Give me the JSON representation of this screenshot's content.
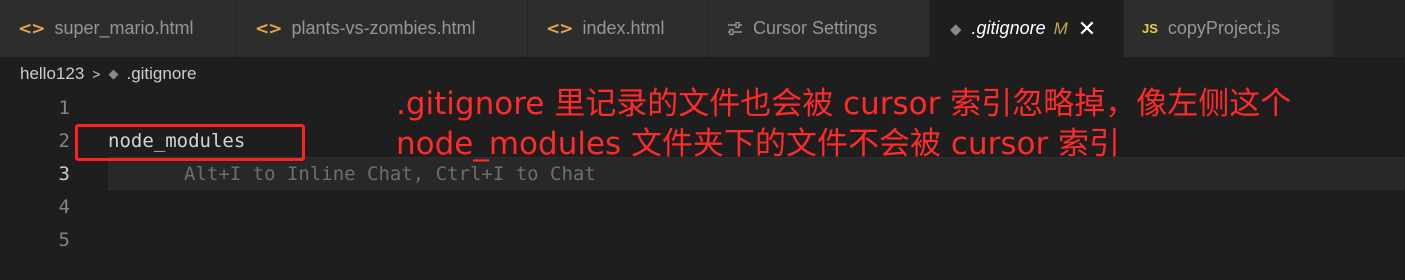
{
  "tabs": [
    {
      "label": "super_mario.html",
      "icon": "html-file-icon"
    },
    {
      "label": "plants-vs-zombies.html",
      "icon": "html-file-icon"
    },
    {
      "label": "index.html",
      "icon": "html-file-icon"
    },
    {
      "label": "Cursor Settings",
      "icon": "settings-sliders-icon"
    },
    {
      "label": ".gitignore",
      "icon": "git-diamond-icon",
      "modified": "M"
    },
    {
      "label": "copyProject.js",
      "icon": "js-file-icon",
      "icon_text": "JS"
    }
  ],
  "breadcrumb": {
    "folder": "hello123",
    "file": ".gitignore"
  },
  "editor": {
    "line_numbers": [
      "1",
      "2",
      "3",
      "4",
      "5"
    ],
    "current_line": "3",
    "line2_text": "node_modules",
    "hint_text": "Alt+I to Inline Chat, Ctrl+I to Chat"
  },
  "annotation": {
    "line1": ".gitignore 里记录的文件也会被 cursor 索引忽略掉，像左侧这个",
    "line2": "node_modules 文件夹下的文件不会被 cursor 索引"
  },
  "colors": {
    "annotation": "#ff2a2a",
    "html_icon": "#e8a548",
    "js_icon": "#e6cd3a",
    "modified": "#c5a552"
  }
}
